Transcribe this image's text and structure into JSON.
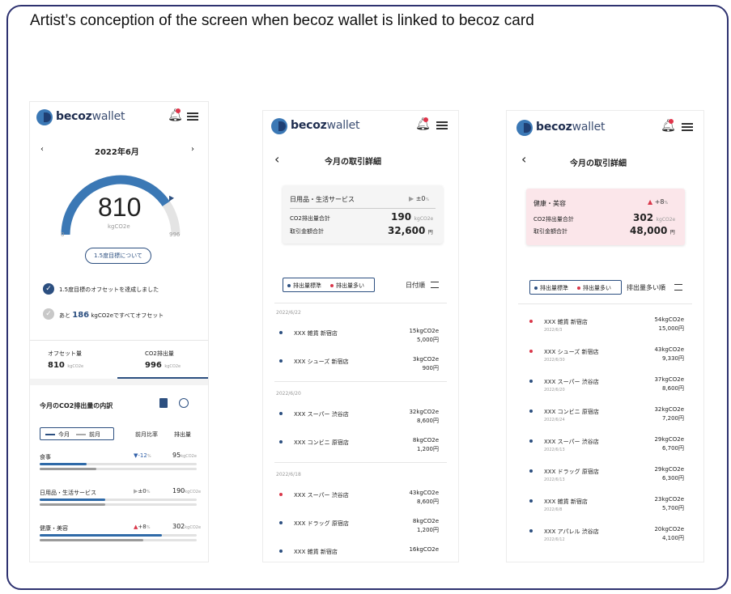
{
  "caption": "Artist’s conception of the screen when becoz wallet is linked to becoz card",
  "brand": {
    "bold": "becoz",
    "light": "wallet"
  },
  "colors": {
    "frame": "#2e3270",
    "accent": "#2c4f80",
    "gauge": "#3b78b5",
    "down": "#2f5fa8",
    "up": "#d9374a",
    "highlight_bg": "#fbe6ea"
  },
  "screen1": {
    "month": "2022年6月",
    "prev_icon": "chevron-left-icon",
    "next_icon": "chevron-right-icon",
    "gauge_value": "810",
    "gauge_unit": "kgCO2e",
    "gauge_min": "0",
    "gauge_max": "996",
    "gauge_fraction": 0.81,
    "target_button": "1.5度目標について",
    "check1": "1.5度目標のオフセットを達成しました",
    "check2_prefix": "あと",
    "check2_value": "186",
    "check2_suffix": "kgCO2eですべてオフセット",
    "tabs": [
      {
        "label": "オフセット量",
        "value": "810",
        "unit": "kgCO2e"
      },
      {
        "label": "CO2排出量",
        "value": "996",
        "unit": "kgCO2e"
      }
    ],
    "breakdown_title": "今月のCO2排出量の内訳",
    "legend_current": "今月",
    "legend_previous": "前月",
    "col_ratio": "前月比率",
    "col_emission": "排出量",
    "categories": [
      {
        "name": "食事",
        "ratio_arrow": "▼",
        "ratio": "-12",
        "ratio_unit": "%",
        "value": "95",
        "unit": "kgCO2e",
        "current_fraction": 0.3,
        "previous_fraction": 0.36
      },
      {
        "name": "日用品・生活サービス",
        "ratio_arrow": "▶",
        "ratio": "±0",
        "ratio_unit": "%",
        "value": "190",
        "unit": "kgCO2e",
        "current_fraction": 0.42,
        "previous_fraction": 0.42
      },
      {
        "name": "健康・美容",
        "ratio_arrow": "▲",
        "ratio": "+8",
        "ratio_unit": "%",
        "value": "302",
        "unit": "kgCO2e",
        "current_fraction": 0.78,
        "previous_fraction": 0.66
      }
    ]
  },
  "screen2": {
    "title": "今月の取引詳細",
    "back_icon": "chevron-left-icon",
    "card": {
      "category": "日用品・生活サービス",
      "ratio": "±0",
      "ratio_unit": "%",
      "emission_label": "CO2排出量合計",
      "emission_value": "190",
      "emission_unit": "kgCO2e",
      "amount_label": "取引金額合計",
      "amount_value": "32,600",
      "amount_unit": "円"
    },
    "filter_std": "排出量標準",
    "filter_high": "排出量多い",
    "sort_label": "日付順",
    "groups": [
      {
        "date": "2022/6/22",
        "items": [
          {
            "name": "XXX 雑貨 新宿店",
            "co2": "15kgCO2e",
            "price": "5,000円",
            "dot": "blue"
          },
          {
            "name": "XXX シューズ 新宿店",
            "co2": "3kgCO2e",
            "price": "900円",
            "dot": "blue"
          }
        ]
      },
      {
        "date": "2022/6/20",
        "items": [
          {
            "name": "XXX スーパー 渋谷店",
            "co2": "32kgCO2e",
            "price": "8,600円",
            "dot": "blue"
          },
          {
            "name": "XXX コンビニ 原宿店",
            "co2": "8kgCO2e",
            "price": "1,200円",
            "dot": "blue"
          }
        ]
      },
      {
        "date": "2022/6/18",
        "items": [
          {
            "name": "XXX スーパー 渋谷店",
            "co2": "43kgCO2e",
            "price": "8,600円",
            "dot": "red"
          },
          {
            "name": "XXX ドラッグ 原宿店",
            "co2": "8kgCO2e",
            "price": "1,200円",
            "dot": "blue"
          },
          {
            "name": "XXX 雑貨 新宿店",
            "co2": "16kgCO2e",
            "price": "",
            "dot": "blue"
          }
        ]
      }
    ]
  },
  "screen3": {
    "title": "今月の取引詳細",
    "back_icon": "chevron-left-icon",
    "card": {
      "category": "健康・美容",
      "ratio": "+8",
      "ratio_unit": "%",
      "emission_label": "CO2排出量合計",
      "emission_value": "302",
      "emission_unit": "kgCO2e",
      "amount_label": "取引金額合計",
      "amount_value": "48,000",
      "amount_unit": "円"
    },
    "filter_std": "排出量標準",
    "filter_high": "排出量多い",
    "sort_label": "排出量多い順",
    "items": [
      {
        "name": "XXX 雑貨 新宿店",
        "date": "2022/6/3",
        "co2": "54kgCO2e",
        "price": "15,000円",
        "dot": "red"
      },
      {
        "name": "XXX シューズ 新宿店",
        "date": "2022/6/30",
        "co2": "43kgCO2e",
        "price": "9,330円",
        "dot": "red"
      },
      {
        "name": "XXX スーパー 渋谷店",
        "date": "2022/6/20",
        "co2": "37kgCO2e",
        "price": "8,600円",
        "dot": "blue"
      },
      {
        "name": "XXX コンビニ 原宿店",
        "date": "2022/6/24",
        "co2": "32kgCO2e",
        "price": "7,200円",
        "dot": "blue"
      },
      {
        "name": "XXX スーパー 渋谷店",
        "date": "2022/6/13",
        "co2": "29kgCO2e",
        "price": "6,700円",
        "dot": "blue"
      },
      {
        "name": "XXX ドラッグ 原宿店",
        "date": "2022/6/13",
        "co2": "29kgCO2e",
        "price": "6,300円",
        "dot": "blue"
      },
      {
        "name": "XXX 雑貨 新宿店",
        "date": "2022/6/8",
        "co2": "23kgCO2e",
        "price": "5,700円",
        "dot": "blue"
      },
      {
        "name": "XXX アパレル 渋谷店",
        "date": "2022/6/12",
        "co2": "20kgCO2e",
        "price": "4,100円",
        "dot": "blue"
      }
    ]
  }
}
